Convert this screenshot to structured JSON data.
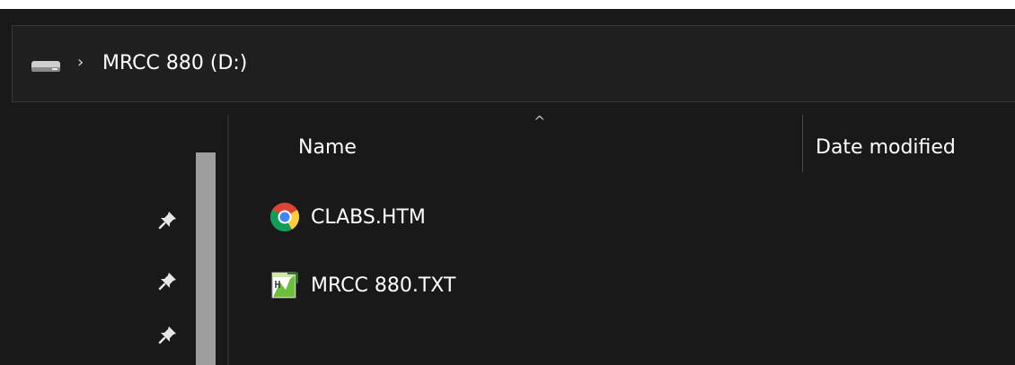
{
  "address_bar": {
    "separator": "›",
    "location": "MRCC 880 (D:)",
    "drive_icon": "drive-icon"
  },
  "columns": {
    "sort_indicator": "^",
    "name": "Name",
    "date_modified": "Date modified"
  },
  "files": [
    {
      "name": "CLABS.HTM",
      "icon": "chrome-icon"
    },
    {
      "name": "MRCC 880.TXT",
      "icon": "text-file-icon"
    }
  ],
  "nav_pane": {
    "pin_icon": "pin-icon",
    "pinned_count": 3
  },
  "colors": {
    "background": "#191919",
    "text": "#ffffff",
    "scrollbar": "#9e9e9e"
  }
}
